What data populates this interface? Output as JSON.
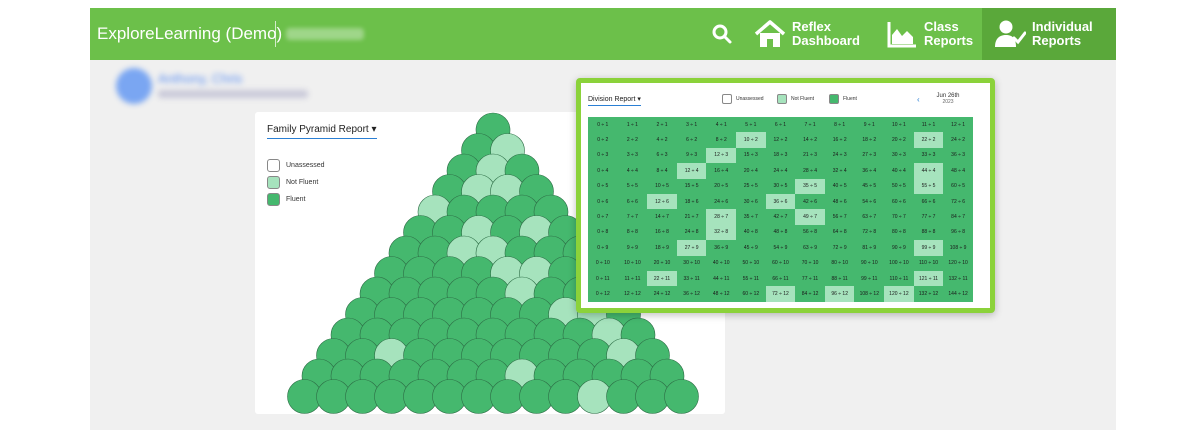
{
  "brand": "ExploreLearning (Demo)",
  "nav": {
    "reflex": "Reflex\nDashboard",
    "class": "Class\nReports",
    "individual": "Individual\nReports"
  },
  "user": {
    "name": "Anthony, Chris"
  },
  "pyramid": {
    "title": "Family Pyramid Report",
    "legend": [
      "Unassessed",
      "Not Fluent",
      "Fluent"
    ]
  },
  "division": {
    "title": "Division Report",
    "legend": [
      "Unassessed",
      "Not Fluent",
      "Fluent"
    ],
    "date": "Jun 26th",
    "year": "2023",
    "rows": [
      [
        "0 ÷ 1",
        "1 ÷ 1",
        "2 ÷ 1",
        "3 ÷ 1",
        "4 ÷ 1",
        "5 ÷ 1",
        "6 ÷ 1",
        "7 ÷ 1",
        "8 ÷ 1",
        "9 ÷ 1",
        "10 ÷ 1",
        "11 ÷ 1",
        "12 ÷ 1"
      ],
      [
        "0 ÷ 2",
        "2 ÷ 2",
        "4 ÷ 2",
        "6 ÷ 2",
        "8 ÷ 2",
        "10 ÷ 2",
        "12 ÷ 2",
        "14 ÷ 2",
        "16 ÷ 2",
        "18 ÷ 2",
        "20 ÷ 2",
        "22 ÷ 2",
        "24 ÷ 2"
      ],
      [
        "0 ÷ 3",
        "3 ÷ 3",
        "6 ÷ 3",
        "9 ÷ 3",
        "12 ÷ 3",
        "15 ÷ 3",
        "18 ÷ 3",
        "21 ÷ 3",
        "24 ÷ 3",
        "27 ÷ 3",
        "30 ÷ 3",
        "33 ÷ 3",
        "36 ÷ 3"
      ],
      [
        "0 ÷ 4",
        "4 ÷ 4",
        "8 ÷ 4",
        "12 ÷ 4",
        "16 ÷ 4",
        "20 ÷ 4",
        "24 ÷ 4",
        "28 ÷ 4",
        "32 ÷ 4",
        "36 ÷ 4",
        "40 ÷ 4",
        "44 ÷ 4",
        "48 ÷ 4"
      ],
      [
        "0 ÷ 5",
        "5 ÷ 5",
        "10 ÷ 5",
        "15 ÷ 5",
        "20 ÷ 5",
        "25 ÷ 5",
        "30 ÷ 5",
        "35 ÷ 5",
        "40 ÷ 5",
        "45 ÷ 5",
        "50 ÷ 5",
        "55 ÷ 5",
        "60 ÷ 5"
      ],
      [
        "0 ÷ 6",
        "6 ÷ 6",
        "12 ÷ 6",
        "18 ÷ 6",
        "24 ÷ 6",
        "30 ÷ 6",
        "36 ÷ 6",
        "42 ÷ 6",
        "48 ÷ 6",
        "54 ÷ 6",
        "60 ÷ 6",
        "66 ÷ 6",
        "72 ÷ 6"
      ],
      [
        "0 ÷ 7",
        "7 ÷ 7",
        "14 ÷ 7",
        "21 ÷ 7",
        "28 ÷ 7",
        "35 ÷ 7",
        "42 ÷ 7",
        "49 ÷ 7",
        "56 ÷ 7",
        "63 ÷ 7",
        "70 ÷ 7",
        "77 ÷ 7",
        "84 ÷ 7"
      ],
      [
        "0 ÷ 8",
        "8 ÷ 8",
        "16 ÷ 8",
        "24 ÷ 8",
        "32 ÷ 8",
        "40 ÷ 8",
        "48 ÷ 8",
        "56 ÷ 8",
        "64 ÷ 8",
        "72 ÷ 8",
        "80 ÷ 8",
        "88 ÷ 8",
        "96 ÷ 8"
      ],
      [
        "0 ÷ 9",
        "9 ÷ 9",
        "18 ÷ 9",
        "27 ÷ 9",
        "36 ÷ 9",
        "45 ÷ 9",
        "54 ÷ 9",
        "63 ÷ 9",
        "72 ÷ 9",
        "81 ÷ 9",
        "90 ÷ 9",
        "99 ÷ 9",
        "108 ÷ 9"
      ],
      [
        "0 ÷ 10",
        "10 ÷ 10",
        "20 ÷ 10",
        "30 ÷ 10",
        "40 ÷ 10",
        "50 ÷ 10",
        "60 ÷ 10",
        "70 ÷ 10",
        "80 ÷ 10",
        "90 ÷ 10",
        "100 ÷ 10",
        "110 ÷ 10",
        "120 ÷ 10"
      ],
      [
        "0 ÷ 11",
        "11 ÷ 11",
        "22 ÷ 11",
        "33 ÷ 11",
        "44 ÷ 11",
        "55 ÷ 11",
        "66 ÷ 11",
        "77 ÷ 11",
        "88 ÷ 11",
        "99 ÷ 11",
        "110 ÷ 11",
        "121 ÷ 11",
        "132 ÷ 11"
      ],
      [
        "0 ÷ 12",
        "12 ÷ 12",
        "24 ÷ 12",
        "36 ÷ 12",
        "48 ÷ 12",
        "60 ÷ 12",
        "72 ÷ 12",
        "84 ÷ 12",
        "96 ÷ 12",
        "108 ÷ 12",
        "120 ÷ 12",
        "132 ÷ 12",
        "144 ÷ 12"
      ]
    ],
    "status": [
      "FFFFFFFFFFFFF",
      "FFFFFNFFFFFNF",
      "FFFFNFFFFFFFF",
      "FFFNFFFFFFFNF",
      "FFFFFFFNFFFNF",
      "FFNFFFNFFFFFF",
      "FFFFNFFNFFFFF",
      "FFFFNFFFFFFFF",
      "FFFNFFFFFFFNF",
      "FFFFFFFFFFFFF",
      "FFNFFFFFFFFNF",
      "FFFFFFNFNFNFF"
    ]
  },
  "colors": {
    "fluent": "#45b86e",
    "not_fluent": "#a6e3bd",
    "unassessed": "#ffffff",
    "brand": "#6cc04a",
    "highlight": "#8bd23a"
  }
}
